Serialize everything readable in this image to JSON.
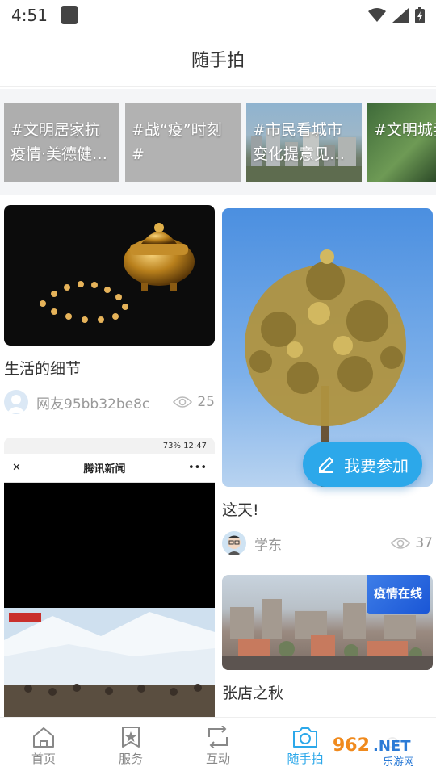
{
  "status": {
    "time": "4:51"
  },
  "header": {
    "title": "随手拍"
  },
  "topics": [
    {
      "label": "#文明居家抗疫情·美德健…"
    },
    {
      "label": "#战“疫”时刻#"
    },
    {
      "label": "#市民看城市变化提意见…"
    },
    {
      "label": "#文明城我他…"
    }
  ],
  "posts": [
    {
      "title": "生活的细节",
      "author": "网友95bb32be8c",
      "views": "25"
    },
    {
      "title": "这天!",
      "author": "学东",
      "views": "37"
    },
    {
      "title": "张店之秋"
    },
    {
      "screenshot_app_title": "腾讯新闻",
      "screenshot_status": "73%  12:47"
    }
  ],
  "badges": {
    "epidemic": "疫情在线"
  },
  "fab": {
    "label": "我要参加"
  },
  "tabs": [
    {
      "label": "首页",
      "icon": "home-icon"
    },
    {
      "label": "服务",
      "icon": "service-icon"
    },
    {
      "label": "互动",
      "icon": "interaction-icon"
    },
    {
      "label": "随手拍",
      "icon": "camera-icon",
      "active": true
    }
  ],
  "watermark": {
    "text": "962.NET",
    "sub": "乐游网"
  },
  "colors": {
    "accent": "#2ca8ea"
  }
}
